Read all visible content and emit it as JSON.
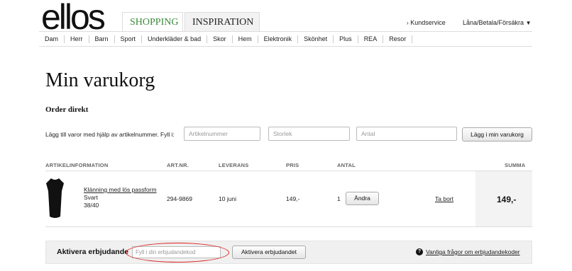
{
  "brand": {
    "logo_text": "ellos"
  },
  "main_tabs": [
    {
      "label": "SHOPPING",
      "active": true
    },
    {
      "label": "INSPIRATION",
      "active": false
    }
  ],
  "top_links": {
    "kundservice": "Kundservice",
    "kundservice_prefix": "›",
    "lana": "Låna/Betala/Försäkra",
    "lana_suffix": "▼"
  },
  "nav": [
    "Dam",
    "Herr",
    "Barn",
    "Sport",
    "Underkläder & bad",
    "Skor",
    "Hem",
    "Elektronik",
    "Skönhet",
    "Plus",
    "REA",
    "Resor"
  ],
  "page": {
    "title": "Min varukorg"
  },
  "order_direct": {
    "title": "Order direkt",
    "instruction": "Lägg till varor med hjälp av artikelnummer. Fyll i:",
    "placeholders": {
      "article": "Artikelnummer",
      "size": "Storlek",
      "qty": "Antal"
    },
    "add_button": "Lägg i min varukorg"
  },
  "cart": {
    "columns": {
      "info": "ARTIKELINFORMATION",
      "artnr": "ART.NR.",
      "delivery": "LEVERANS",
      "price": "PRIS",
      "qty": "ANTAL",
      "sum": "SUMMA"
    },
    "items": [
      {
        "name": "Klänning med lös passform",
        "color": "Svart",
        "size": "38/40",
        "artnr": "294-9869",
        "delivery": "10 juni",
        "price": "149,-",
        "qty": "1",
        "change_label": "Ändra",
        "remove_label": "Ta bort",
        "sum": "149,-"
      }
    ]
  },
  "promo": {
    "label": "Aktivera erbjudande",
    "placeholder": "Fyll i din erbjudandekod",
    "button": "Aktivera erbjudandet",
    "help_icon_glyph": "?",
    "help_link": "Vanliga frågor om erbjudandekoder"
  },
  "colors": {
    "active_tab_text": "#3a8a3a",
    "annotation_ring": "#dd2222"
  }
}
